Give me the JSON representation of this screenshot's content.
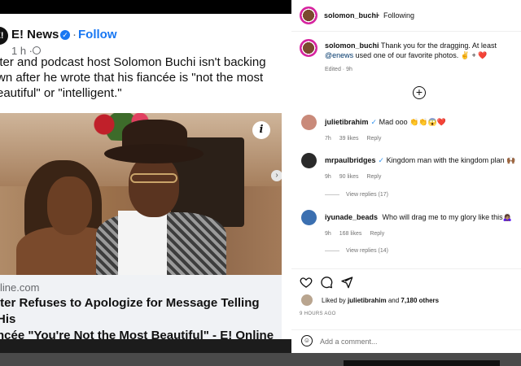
{
  "facebook_post": {
    "logo_text": "E!",
    "page_name": "E! News",
    "separator": "·",
    "follow_label": "Follow",
    "time": "1 h ·",
    "text": "iter and podcast host Solomon Buchi isn't backing\nwn after he wrote that his fiancée is \"not the most\neautiful\" or \"intelligent.\"",
    "info_icon_label": "i",
    "link_domain": "line.com",
    "link_title": "iter Refuses to Apologize for Message Telling His\nncée \"You're Not the Most Beautiful\" - E! Online"
  },
  "instagram": {
    "header": {
      "username": "solomon_buchi",
      "separator": "•",
      "following": "Following"
    },
    "caption": {
      "username": "solomon_buchi",
      "text": "Thank you for the dragging. At least ",
      "mention": "@enews",
      "text2": "used one of our favorite photos. ✌️ + ❤️",
      "edited": "Edited · 9h"
    },
    "comments": [
      {
        "username": "julietibrahim",
        "verified": true,
        "text": "Mad ooo 👏👏😱❤️",
        "time": "7h",
        "likes": "39 likes",
        "reply": "Reply",
        "view_replies": ""
      },
      {
        "username": "mrpaulbridges",
        "verified": true,
        "text": "Kingdom man with the kingdom plan 🙌🏾",
        "time": "9h",
        "likes": "90 likes",
        "reply": "Reply",
        "view_replies": "View replies (17)"
      },
      {
        "username": "iyunade_beads",
        "verified": false,
        "text": "Who will drag me to my glory like this🙇🏽‍♀️",
        "time": "9h",
        "likes": "168 likes",
        "reply": "Reply",
        "view_replies": "View replies (14)"
      }
    ],
    "likes": {
      "prefix": "Liked by",
      "user": "julietibrahim",
      "middle": "and",
      "others": "7,180 others"
    },
    "time_ago": "9 HOURS AGO",
    "add_comment_placeholder": "Add a comment...",
    "icons": [
      "heart-icon",
      "comment-icon",
      "share-icon",
      "emoji-icon",
      "plus-circle-icon"
    ]
  }
}
